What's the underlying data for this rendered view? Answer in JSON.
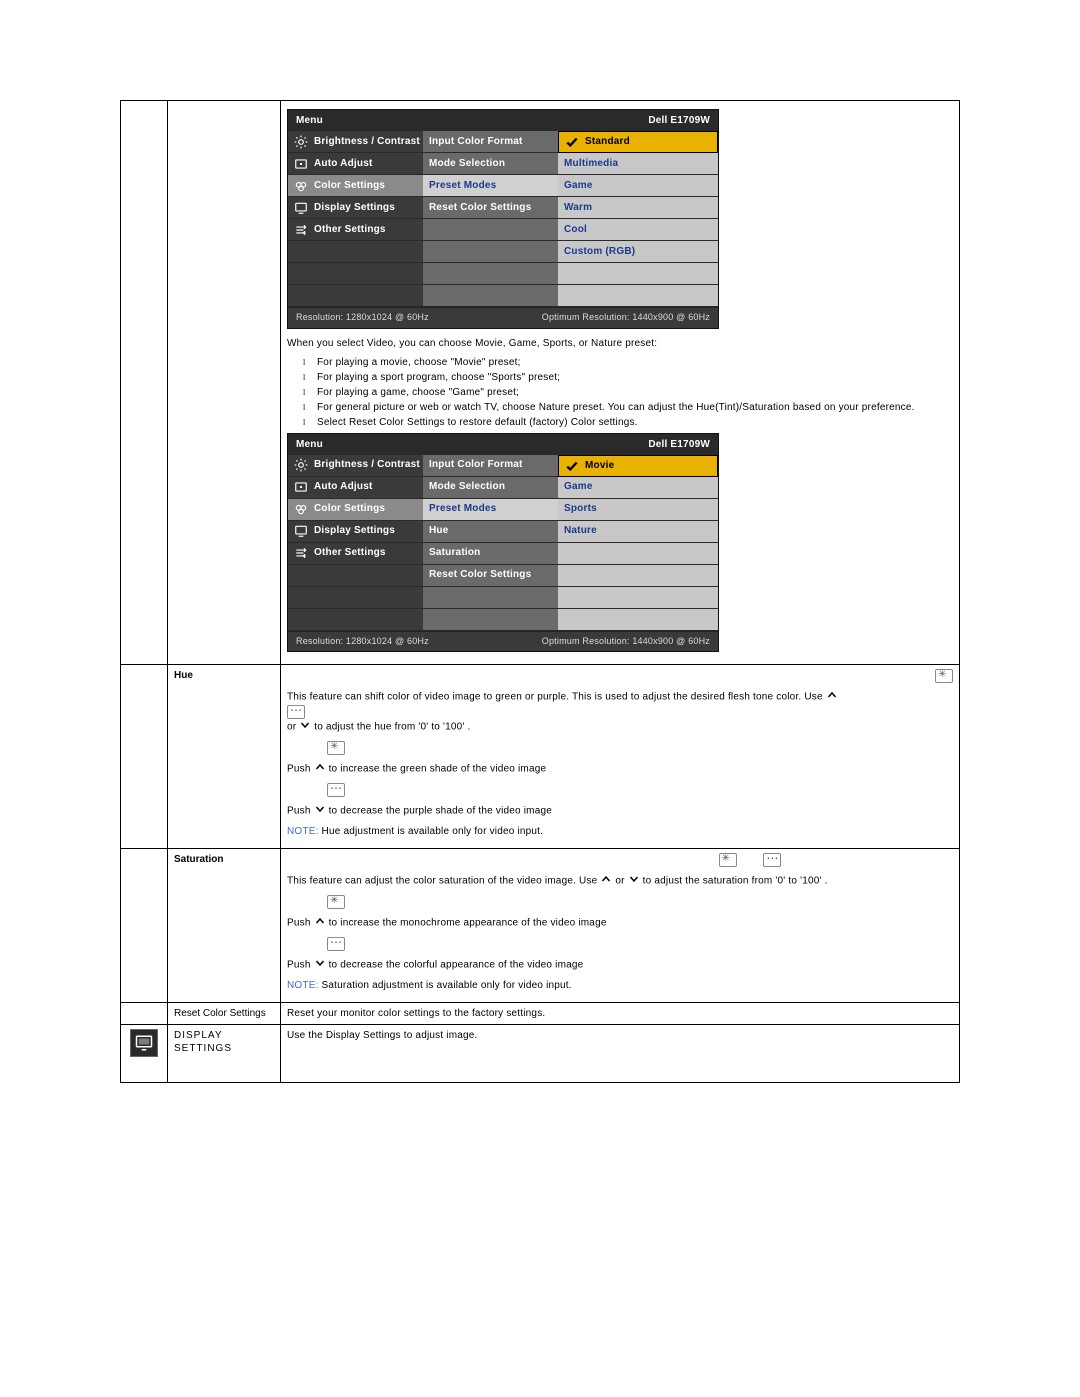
{
  "osd1": {
    "title_left": "Menu",
    "title_right": "Dell E1709W",
    "col1": [
      {
        "icon": "brightness",
        "label": "Brightness / Contrast"
      },
      {
        "icon": "auto",
        "label": "Auto Adjust"
      },
      {
        "icon": "color",
        "label": "Color Settings",
        "selected": true
      },
      {
        "icon": "display",
        "label": "Display Settings"
      },
      {
        "icon": "other",
        "label": "Other Settings"
      }
    ],
    "col2": [
      {
        "label": "Input Color Format"
      },
      {
        "label": "Mode Selection"
      },
      {
        "label": "Preset Modes",
        "selected": true
      },
      {
        "label": "Reset Color Settings"
      }
    ],
    "col3": [
      {
        "label": "Standard",
        "selected": true,
        "check": true
      },
      {
        "label": "Multimedia"
      },
      {
        "label": "Game"
      },
      {
        "label": "Warm"
      },
      {
        "label": "Cool"
      },
      {
        "label": "Custom (RGB)"
      }
    ],
    "footer_left": "Resolution: 1280x1024 @ 60Hz",
    "footer_right": "Optimum Resolution: 1440x900 @ 60Hz"
  },
  "osd2": {
    "title_left": "Menu",
    "title_right": "Dell E1709W",
    "col1": [
      {
        "icon": "brightness",
        "label": "Brightness / Contrast"
      },
      {
        "icon": "auto",
        "label": "Auto Adjust"
      },
      {
        "icon": "color",
        "label": "Color Settings",
        "selected": true
      },
      {
        "icon": "display",
        "label": "Display Settings"
      },
      {
        "icon": "other",
        "label": "Other Settings"
      }
    ],
    "col2": [
      {
        "label": "Input Color Format"
      },
      {
        "label": "Mode Selection"
      },
      {
        "label": "Preset Modes",
        "selected": true
      },
      {
        "label": "Hue"
      },
      {
        "label": "Saturation"
      },
      {
        "label": "Reset Color Settings"
      }
    ],
    "col3": [
      {
        "label": "Movie",
        "selected": true,
        "check": true
      },
      {
        "label": "Game"
      },
      {
        "label": "Sports"
      },
      {
        "label": "Nature"
      }
    ],
    "footer_left": "Resolution: 1280x1024 @ 60Hz",
    "footer_right": "Optimum Resolution: 1440x900 @ 60Hz"
  },
  "text": {
    "video_intro": "When you select Video, you can choose Movie, Game, Sports, or Nature preset:",
    "bullets": [
      "For playing a movie, choose \"Movie\" preset;",
      "For playing a sport program, choose \"Sports\" preset;",
      "For playing a game, choose \"Game\" preset;",
      "For general picture or web or watch TV, choose Nature preset. You can adjust the Hue(Tint)/Saturation based on your preference.",
      "Select Reset Color Settings to restore default (factory) Color settings."
    ],
    "hue_label": "Hue",
    "hue_p1a": "This feature can shift color of video image to green or purple. This is used to adjust the desired flesh tone color. Use ",
    "hue_p1b": " or ",
    "hue_p1c": " to adjust the hue from '0' to '100' .",
    "hue_push_up": "Push ",
    "hue_push_up_after": " to increase the green shade of the video image",
    "hue_push_down": "Push ",
    "hue_push_down_after": " to decrease the purple shade of the video image",
    "hue_note_label": "NOTE:",
    "hue_note": " Hue adjustment is available only for video input.",
    "sat_label": "Saturation",
    "sat_p1a": "This feature can adjust the color saturation of the video image. Use ",
    "sat_p1b": " or ",
    "sat_p1c": " to adjust the saturation from '0' to '100' .",
    "sat_push_up": "Push ",
    "sat_push_up_after": " to increase the monochrome appearance of the video image",
    "sat_push_down": "Push ",
    "sat_push_down_after": " to decrease the colorful appearance of the video image",
    "sat_note_label": "NOTE:",
    "sat_note": " Saturation adjustment is available only for video input.",
    "reset_label": "Reset Color Settings",
    "reset_desc": "Reset your monitor color settings to the factory settings.",
    "display_label": "DISPLAY SETTINGS",
    "display_desc": "Use the Display Settings to adjust image."
  }
}
